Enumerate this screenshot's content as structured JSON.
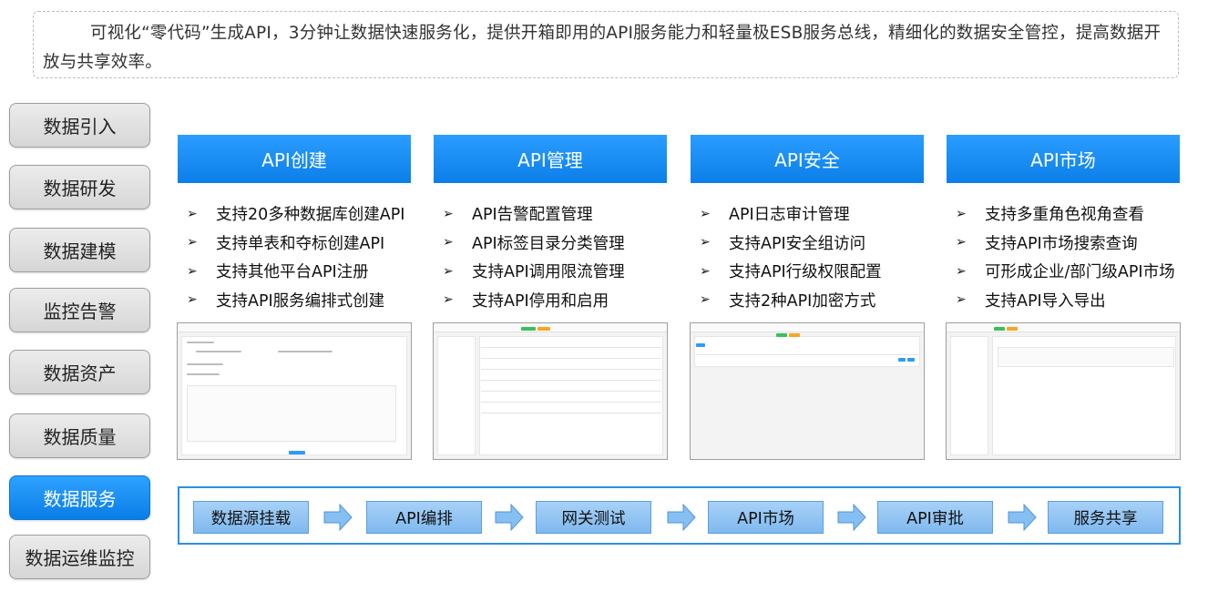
{
  "intro": {
    "text": "可视化“零代码”生成API，3分钟让数据快速服务化，提供开箱即用的API服务能力和轻量极ESB服务总线，精细化的数据安全管控，提高数据开放与共享效率。"
  },
  "nav": {
    "items": [
      {
        "label": "数据引入"
      },
      {
        "label": "数据研发"
      },
      {
        "label": "数据建模"
      },
      {
        "label": "监控告警"
      },
      {
        "label": "数据资产"
      },
      {
        "label": "数据质量"
      },
      {
        "label": "数据服务",
        "active": true
      },
      {
        "label": "数据运维监控"
      }
    ]
  },
  "columns": [
    {
      "title": "API创建",
      "features": [
        "支持20多种数据库创建API",
        "支持单表和夺标创建API",
        "支持其他平台API注册",
        "支持API服务编排式创建"
      ]
    },
    {
      "title": "API管理",
      "features": [
        "API告警配置管理",
        "API标签目录分类管理",
        "支持API调用限流管理",
        "支持API停用和启用"
      ]
    },
    {
      "title": "API安全",
      "features": [
        "API日志审计管理",
        "支持API安全组访问",
        "支持API行级权限配置",
        "支持2种API加密方式"
      ]
    },
    {
      "title": "API市场",
      "features": [
        "支持多重角色视角查看",
        "支持API市场搜索查询",
        "可形成企业/部门级API市场",
        "支持API导入导出"
      ]
    }
  ],
  "flow": {
    "steps": [
      {
        "label": "数据源挂载"
      },
      {
        "label": "API编排"
      },
      {
        "label": "网关测试"
      },
      {
        "label": "API市场"
      },
      {
        "label": "API审批"
      },
      {
        "label": "服务共享"
      }
    ]
  },
  "colors": {
    "accent": "#0b7fe8",
    "flow_border": "#2a8fe8",
    "step_fill": "#8ec3f2",
    "nav_inactive": "#dcdcdc"
  },
  "icons": {
    "feature_bullet": "arrowhead-right-icon",
    "flow_arrow": "block-arrow-right-icon"
  }
}
